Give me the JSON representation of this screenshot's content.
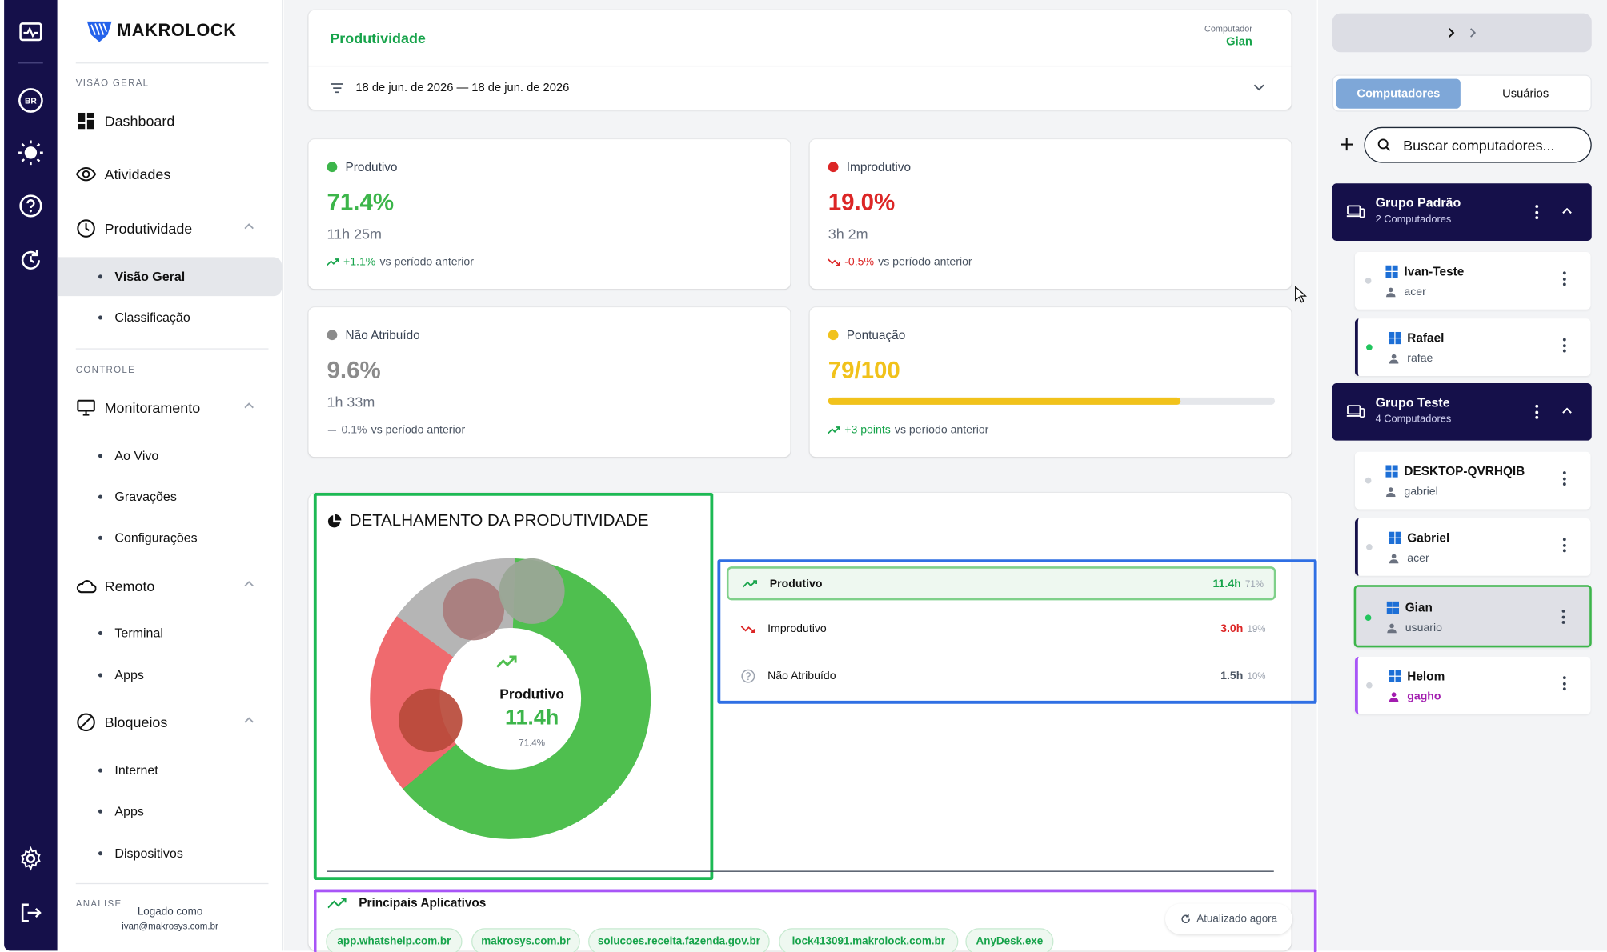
{
  "brand": {
    "name": "MAKROLOCK"
  },
  "rail": {
    "badge": "BR"
  },
  "sidebar": {
    "section_overview": "VISÃO GERAL",
    "section_control": "CONTROLE",
    "section_analysis": "ANÁLISE",
    "dashboard": "Dashboard",
    "activities": "Atividades",
    "productivity": "Produtividade",
    "prod_overview": "Visão Geral",
    "prod_classification": "Classificação",
    "monitoring": "Monitoramento",
    "live": "Ao Vivo",
    "recordings": "Gravações",
    "settings": "Configurações",
    "remote": "Remoto",
    "terminal": "Terminal",
    "remote_apps": "Apps",
    "blocks": "Bloqueios",
    "internet": "Internet",
    "block_apps": "Apps",
    "devices": "Dispositivos",
    "logged_label": "Logado como",
    "logged_email": "ivan@makrosys.com.br"
  },
  "header": {
    "title": "Produtividade",
    "computer_label": "Computador",
    "computer_value": "Gian",
    "date_range": "18 de jun. de 2026 — 18 de jun. de 2026"
  },
  "stats": {
    "productive": {
      "label": "Produtivo",
      "value": "71.4%",
      "time": "11h 25m",
      "delta": "+1.1%",
      "suffix": "vs período anterior"
    },
    "unproductive": {
      "label": "Improdutivo",
      "value": "19.0%",
      "time": "3h 2m",
      "delta": "-0.5%",
      "suffix": "vs período anterior"
    },
    "unassigned": {
      "label": "Não Atribuído",
      "value": "9.6%",
      "time": "1h 33m",
      "delta": "0.1%",
      "suffix": "vs período anterior"
    },
    "score": {
      "label": "Pontuação",
      "value": "79/100",
      "score_fraction": 0.79,
      "delta": "+3 points",
      "suffix": "vs período anterior"
    }
  },
  "breakdown": {
    "title": "DETALHAMENTO DA PRODUTIVIDADE",
    "center_label": "Produtivo",
    "center_value": "11.4h",
    "center_pct": "71.4%",
    "rows": [
      {
        "label": "Produtivo",
        "value": "11.4h",
        "pct": "71%"
      },
      {
        "label": "Improdutivo",
        "value": "3.0h",
        "pct": "19%"
      },
      {
        "label": "Não Atribuído",
        "value": "1.5h",
        "pct": "10%"
      }
    ]
  },
  "apps": {
    "title": "Principais Aplicativos",
    "updated": "Atualizado agora",
    "chips": [
      "app.whatshelp.com.br",
      "makrosys.com.br",
      "solucoes.receita.fazenda.gov.br",
      "lock413091.makrolock.com.br",
      "AnyDesk.exe"
    ]
  },
  "right": {
    "tab_computers": "Computadores",
    "tab_users": "Usuários",
    "search_placeholder": "Buscar computadores...",
    "group1": {
      "name": "Grupo Padrão",
      "count": "2 Computadores"
    },
    "group2": {
      "name": "Grupo Teste",
      "count": "4 Computadores"
    },
    "computers": [
      {
        "name": "Ivan-Teste",
        "user": "acer"
      },
      {
        "name": "Rafael",
        "user": "rafae"
      },
      {
        "name": "DESKTOP-QVRHQIB",
        "user": "gabriel"
      },
      {
        "name": "Gabriel",
        "user": "acer"
      },
      {
        "name": "Gian",
        "user": "usuario"
      },
      {
        "name": "Helom",
        "user": "gagho"
      }
    ]
  },
  "colors": {
    "navy": "#15104a",
    "green": "#3cb54a",
    "red": "#dc2626",
    "gray": "#8b8b8b",
    "yellow": "#f1c21b",
    "purple": "#a855f7",
    "blue": "#3b82f6"
  }
}
